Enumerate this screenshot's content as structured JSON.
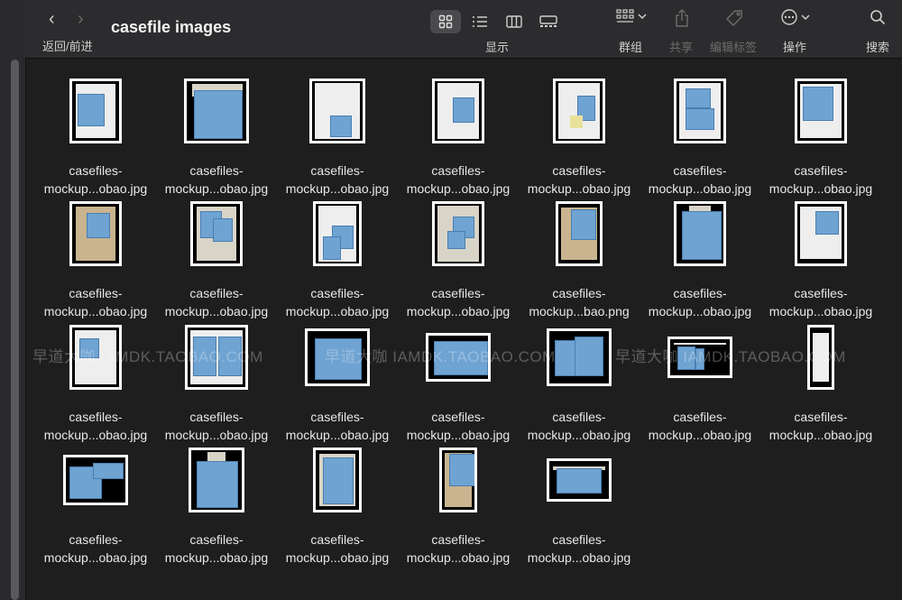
{
  "window": {
    "title": "casefile images"
  },
  "nav": {
    "back_icon": "‹",
    "forward_icon": "›",
    "label": "返回/前进"
  },
  "toolbar": {
    "view_label": "显示",
    "group_label": "群组",
    "share_label": "共享",
    "tags_label": "编辑标签",
    "action_label": "操作",
    "search_label": "搜索"
  },
  "files": [
    {
      "line1": "casefiles-",
      "line2": "mockup...obao.jpg"
    },
    {
      "line1": "casefiles-",
      "line2": "mockup...obao.jpg"
    },
    {
      "line1": "casefiles-",
      "line2": "mockup...obao.jpg"
    },
    {
      "line1": "casefiles-",
      "line2": "mockup...obao.jpg"
    },
    {
      "line1": "casefiles-",
      "line2": "mockup...obao.jpg"
    },
    {
      "line1": "casefiles-",
      "line2": "mockup...obao.jpg"
    },
    {
      "line1": "casefiles-",
      "line2": "mockup...obao.jpg"
    },
    {
      "line1": "casefiles-",
      "line2": "mockup...obao.jpg"
    },
    {
      "line1": "casefiles-",
      "line2": "mockup...obao.jpg"
    },
    {
      "line1": "casefiles-",
      "line2": "mockup...obao.jpg"
    },
    {
      "line1": "casefiles-",
      "line2": "mockup...obao.jpg"
    },
    {
      "line1": "casefiles-",
      "line2": "mockup...bao.png"
    },
    {
      "line1": "casefiles-",
      "line2": "mockup...obao.jpg"
    },
    {
      "line1": "casefiles-",
      "line2": "mockup...obao.jpg"
    },
    {
      "line1": "casefiles-",
      "line2": "mockup...obao.jpg"
    },
    {
      "line1": "casefiles-",
      "line2": "mockup...obao.jpg"
    },
    {
      "line1": "casefiles-",
      "line2": "mockup...obao.jpg"
    },
    {
      "line1": "casefiles-",
      "line2": "mockup...obao.jpg"
    },
    {
      "line1": "casefiles-",
      "line2": "mockup...obao.jpg"
    },
    {
      "line1": "casefiles-",
      "line2": "mockup...obao.jpg"
    },
    {
      "line1": "casefiles-",
      "line2": "mockup...obao.jpg"
    },
    {
      "line1": "casefiles-",
      "line2": "mockup...obao.jpg"
    },
    {
      "line1": "casefiles-",
      "line2": "mockup...obao.jpg"
    },
    {
      "line1": "casefiles-",
      "line2": "mockup...obao.jpg"
    },
    {
      "line1": "casefiles-",
      "line2": "mockup...obao.jpg"
    },
    {
      "line1": "casefiles-",
      "line2": "mockup...obao.jpg"
    }
  ],
  "watermark": {
    "text": "早道大咖  IAMDK.TAOBAO.COM"
  },
  "colors": {
    "background": "#1e1e1f",
    "toolbar": "#2c2c2e",
    "thumb_border": "#ffffff",
    "mock_blue": "#6fa3d2"
  }
}
